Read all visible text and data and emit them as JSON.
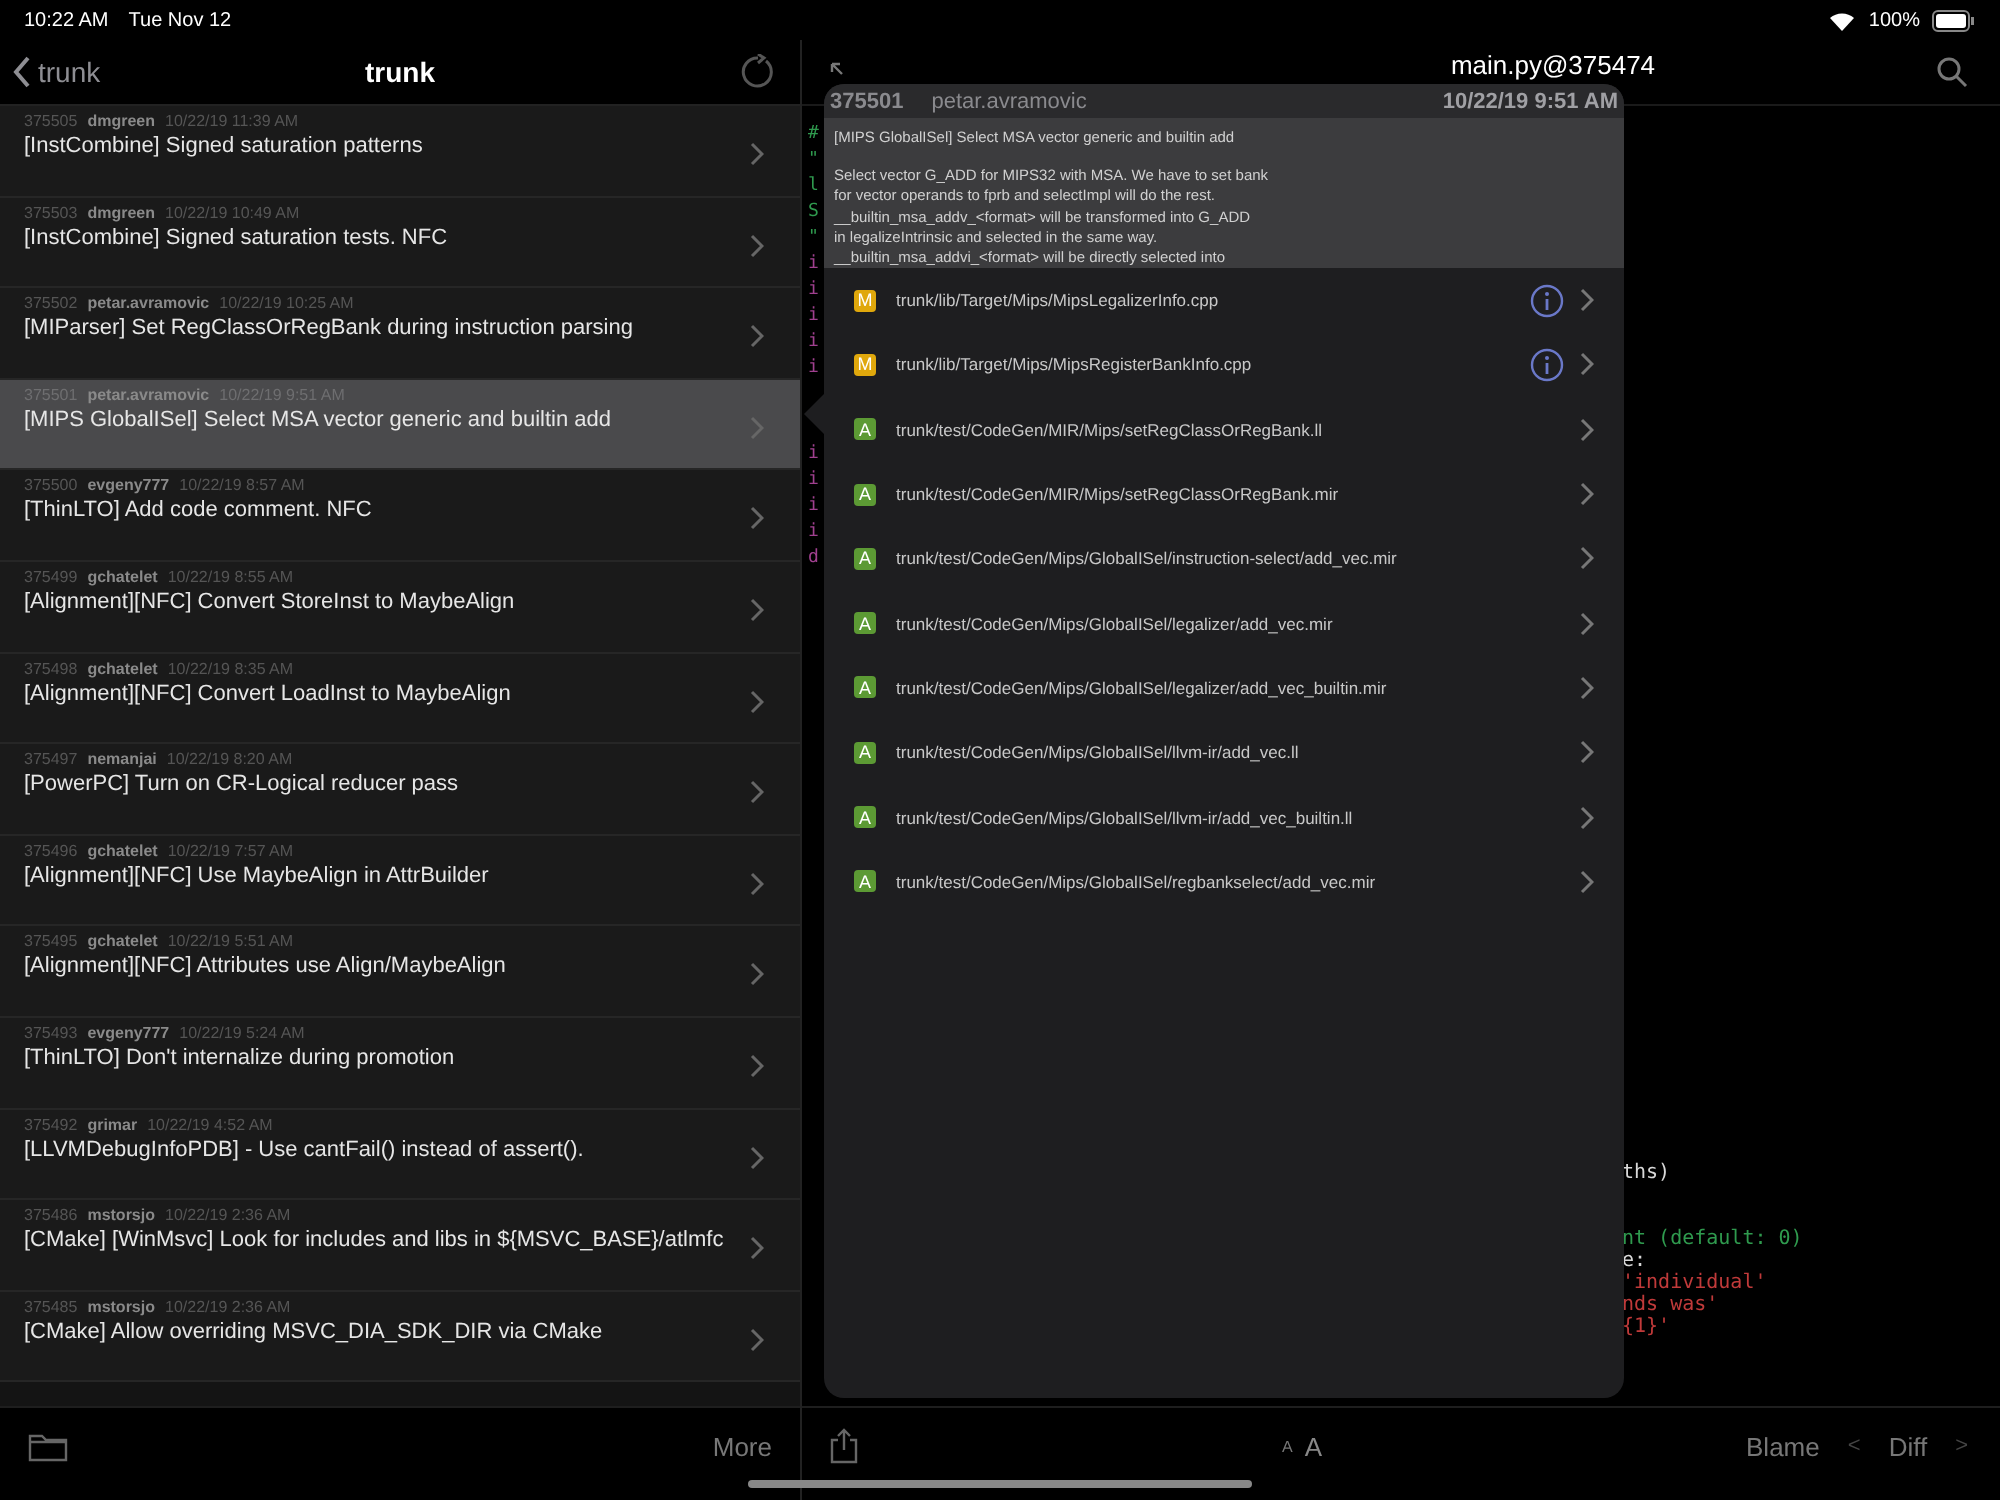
{
  "status_bar": {
    "time": "10:22 AM",
    "date": "Tue Nov 12",
    "battery": "100%"
  },
  "left_nav": {
    "back_label": "trunk",
    "title": "trunk"
  },
  "commits": [
    {
      "revision": "375505",
      "author": "dmgreen",
      "date": "10/22/19 11:39 AM",
      "message": "[InstCombine] Signed saturation patterns",
      "selected": false
    },
    {
      "revision": "375503",
      "author": "dmgreen",
      "date": "10/22/19 10:49 AM",
      "message": "[InstCombine] Signed saturation tests. NFC",
      "selected": false
    },
    {
      "revision": "375502",
      "author": "petar.avramovic",
      "date": "10/22/19 10:25 AM",
      "message": "[MIParser] Set RegClassOrRegBank during instruction parsing",
      "selected": false
    },
    {
      "revision": "375501",
      "author": "petar.avramovic",
      "date": "10/22/19 9:51 AM",
      "message": "[MIPS GlobalISel] Select MSA vector generic and builtin add",
      "selected": true
    },
    {
      "revision": "375500",
      "author": "evgeny777",
      "date": "10/22/19 8:57 AM",
      "message": "[ThinLTO] Add code comment. NFC",
      "selected": false
    },
    {
      "revision": "375499",
      "author": "gchatelet",
      "date": "10/22/19 8:55 AM",
      "message": "[Alignment][NFC] Convert StoreInst to MaybeAlign",
      "selected": false
    },
    {
      "revision": "375498",
      "author": "gchatelet",
      "date": "10/22/19 8:35 AM",
      "message": "[Alignment][NFC] Convert LoadInst to MaybeAlign",
      "selected": false
    },
    {
      "revision": "375497",
      "author": "nemanjai",
      "date": "10/22/19 8:20 AM",
      "message": "[PowerPC] Turn on CR-Logical reducer pass",
      "selected": false
    },
    {
      "revision": "375496",
      "author": "gchatelet",
      "date": "10/22/19 7:57 AM",
      "message": "[Alignment][NFC] Use MaybeAlign in AttrBuilder",
      "selected": false
    },
    {
      "revision": "375495",
      "author": "gchatelet",
      "date": "10/22/19 5:51 AM",
      "message": "[Alignment][NFC] Attributes use Align/MaybeAlign",
      "selected": false
    },
    {
      "revision": "375493",
      "author": "evgeny777",
      "date": "10/22/19 5:24 AM",
      "message": "[ThinLTO] Don't internalize during promotion",
      "selected": false
    },
    {
      "revision": "375492",
      "author": "grimar",
      "date": "10/22/19 4:52 AM",
      "message": "[LLVMDebugInfoPDB] - Use cantFail() instead of assert().",
      "selected": false
    },
    {
      "revision": "375486",
      "author": "mstorsjo",
      "date": "10/22/19 2:36 AM",
      "message": "[CMake] [WinMsvc] Look for includes and libs in ${MSVC_BASE}/atlmfc",
      "selected": false
    },
    {
      "revision": "375485",
      "author": "mstorsjo",
      "date": "10/22/19 2:36 AM",
      "message": "[CMake] Allow overriding MSVC_DIA_SDK_DIR via CMake",
      "selected": false
    }
  ],
  "left_toolbar": {
    "more": "More"
  },
  "editor": {
    "title": "main.py@375474",
    "code_left": [
      {
        "text": "#",
        "kind": "comment"
      },
      {
        "text": "\"",
        "kind": "comment"
      },
      {
        "text": "l",
        "kind": "comment"
      },
      {
        "text": "S",
        "kind": "comment"
      },
      {
        "text": "\"",
        "kind": "comment"
      },
      {
        "text": "i",
        "kind": "keyword"
      },
      {
        "text": "i",
        "kind": "keyword"
      },
      {
        "text": "i",
        "kind": "keyword"
      },
      {
        "text": "i",
        "kind": "keyword"
      },
      {
        "text": "i",
        "kind": "keyword"
      },
      {
        "text": "i",
        "kind": "keyword"
      },
      {
        "text": "i",
        "kind": "keyword"
      },
      {
        "text": "i",
        "kind": "keyword"
      },
      {
        "text": "i",
        "kind": "keyword"
      },
      {
        "text": "d",
        "kind": "keyword"
      }
    ],
    "code_right": [
      {
        "text": "ths)",
        "kind": "plain"
      },
      {
        "text": "nt (default: 0)",
        "kind": "comment"
      },
      {
        "text": "e:",
        "kind": "plain"
      },
      {
        "text": "'individual'",
        "kind": "string"
      },
      {
        "text": "nds was'",
        "kind": "string"
      },
      {
        "text": "{1}'",
        "kind": "string"
      }
    ]
  },
  "popover": {
    "revision": "375501",
    "author": "petar.avramovic",
    "date": "10/22/19 9:51 AM",
    "message_title": "[MIPS GlobalISel] Select MSA vector generic and builtin add",
    "message_lines": [
      "Select vector G_ADD for MIPS32 with MSA. We have to set bank",
      "for vector operands to fprb and selectImpl will do the rest.",
      "__builtin_msa_addv_<format> will be transformed into G_ADD",
      "in legalizeIntrinsic and selected in the same way.",
      "__builtin_msa_addvi_<format> will be directly selected into"
    ],
    "files": [
      {
        "status": "M",
        "kind": "modified",
        "path": "trunk/lib/Target/Mips/MipsLegalizerInfo.cpp",
        "info": true
      },
      {
        "status": "M",
        "kind": "modified",
        "path": "trunk/lib/Target/Mips/MipsRegisterBankInfo.cpp",
        "info": true
      },
      {
        "status": "A",
        "kind": "added",
        "path": "trunk/test/CodeGen/MIR/Mips/setRegClassOrRegBank.ll",
        "info": false
      },
      {
        "status": "A",
        "kind": "added",
        "path": "trunk/test/CodeGen/MIR/Mips/setRegClassOrRegBank.mir",
        "info": false
      },
      {
        "status": "A",
        "kind": "added",
        "path": "trunk/test/CodeGen/Mips/GlobalISel/instruction-select/add_vec.mir",
        "info": false
      },
      {
        "status": "A",
        "kind": "added",
        "path": "trunk/test/CodeGen/Mips/GlobalISel/legalizer/add_vec.mir",
        "info": false
      },
      {
        "status": "A",
        "kind": "added",
        "path": "trunk/test/CodeGen/Mips/GlobalISel/legalizer/add_vec_builtin.mir",
        "info": false
      },
      {
        "status": "A",
        "kind": "added",
        "path": "trunk/test/CodeGen/Mips/GlobalISel/llvm-ir/add_vec.ll",
        "info": false
      },
      {
        "status": "A",
        "kind": "added",
        "path": "trunk/test/CodeGen/Mips/GlobalISel/llvm-ir/add_vec_builtin.ll",
        "info": false
      },
      {
        "status": "A",
        "kind": "added",
        "path": "trunk/test/CodeGen/Mips/GlobalISel/regbankselect/add_vec.mir",
        "info": false
      }
    ]
  },
  "right_toolbar": {
    "font_small": "A",
    "font_large": "A",
    "blame": "Blame",
    "prev": "<",
    "diff": "Diff",
    "next": ">"
  }
}
